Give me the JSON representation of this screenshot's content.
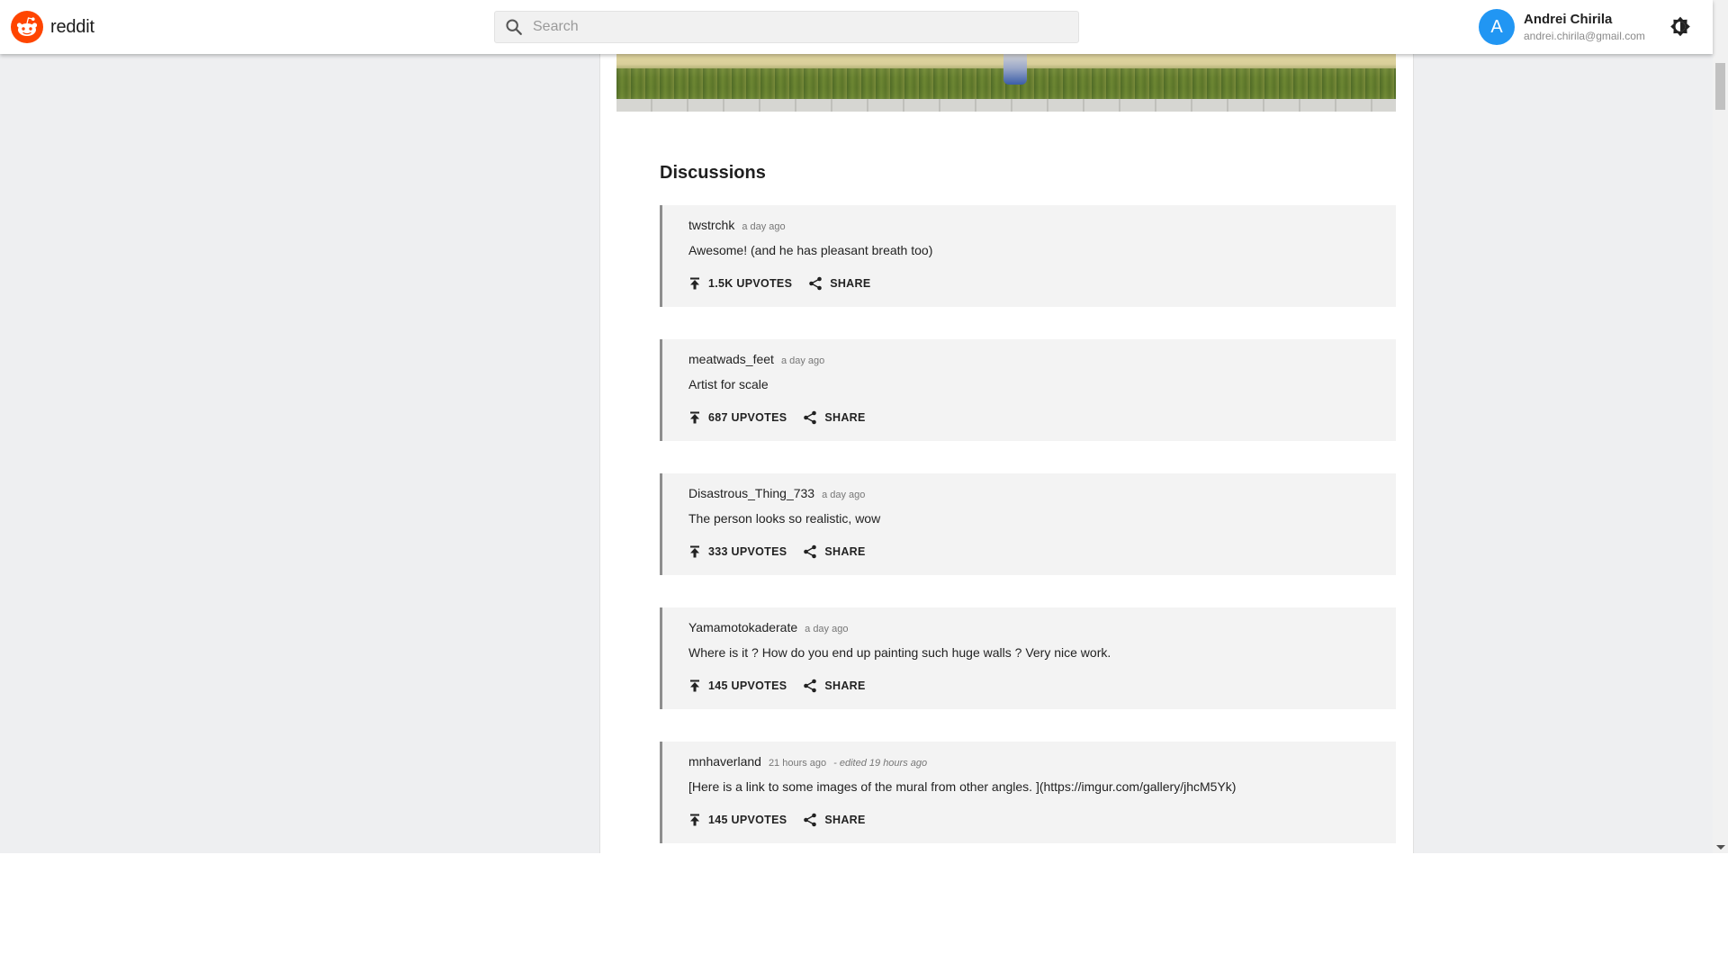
{
  "header": {
    "logo_text": "reddit",
    "search_placeholder": "Search",
    "user": {
      "initial": "A",
      "name": "Andrei Chirila",
      "email": "andrei.chirila@gmail.com"
    }
  },
  "colors": {
    "brand": "#ff4500",
    "avatar": "#2196f3",
    "page_bg": "#eeeff1",
    "comment_bg": "#f3f3f3",
    "comment_border": "#8e8e8e"
  },
  "icons": {
    "logo": "reddit-alien-icon",
    "search": "search-icon",
    "theme": "brightness-icon",
    "upvote": "upvote-arrow-icon",
    "share": "share-icon"
  },
  "discussions": {
    "title": "Discussions",
    "comments": [
      {
        "author": "twstrchk",
        "time": "a day ago",
        "edited": "",
        "body": "Awesome! (and he has pleasant breath too)",
        "upvotes": "1.5K UPVOTES",
        "share": "SHARE"
      },
      {
        "author": "meatwads_feet",
        "time": "a day ago",
        "edited": "",
        "body": "Artist for scale",
        "upvotes": "687 UPVOTES",
        "share": "SHARE"
      },
      {
        "author": "Disastrous_Thing_733",
        "time": "a day ago",
        "edited": "",
        "body": "The person looks so realistic, wow",
        "upvotes": "333 UPVOTES",
        "share": "SHARE"
      },
      {
        "author": "Yamamotokaderate",
        "time": "a day ago",
        "edited": "",
        "body": "Where is it ? How do you end up painting such huge walls ? Very nice work.",
        "upvotes": "145 UPVOTES",
        "share": "SHARE"
      },
      {
        "author": "mnhaverland",
        "time": "21 hours ago",
        "edited": "- edited 19 hours ago",
        "body": "[Here is a link to some images of the mural from other angles. ](https://imgur.com/gallery/jhcM5Yk)",
        "upvotes": "145 UPVOTES",
        "share": "SHARE"
      }
    ]
  }
}
